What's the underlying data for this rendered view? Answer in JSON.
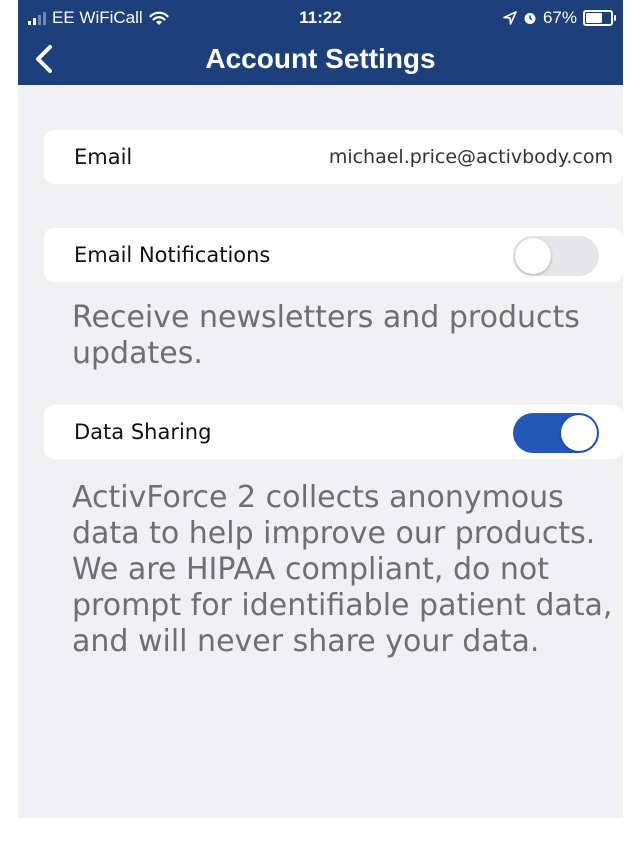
{
  "status_bar": {
    "carrier": "EE WiFiCall",
    "time": "11:22",
    "battery": "67%",
    "battery_level": 0.67,
    "icons": [
      "signal-icon",
      "wifi-icon",
      "location-icon",
      "alarm-icon",
      "battery-icon"
    ]
  },
  "nav": {
    "title": "Account Settings",
    "back_icon": "chevron-left-icon"
  },
  "email": {
    "label": "Email",
    "value": "michael.price@activbody.com"
  },
  "email_notifications": {
    "label": "Email Notifications",
    "enabled": false,
    "description": "Receive newsletters and products updates."
  },
  "data_sharing": {
    "label": "Data Sharing",
    "enabled": true,
    "description": "ActivForce 2 collects anonymous data to help improve our products. We are HIPAA compliant, do not prompt for identifiable patient data, and will never share your data."
  },
  "colors": {
    "nav_background": "#1d3f7a",
    "toggle_on": "#2357b8",
    "toggle_off": "#e5e5ea",
    "page_background": "#f1f1f3"
  }
}
